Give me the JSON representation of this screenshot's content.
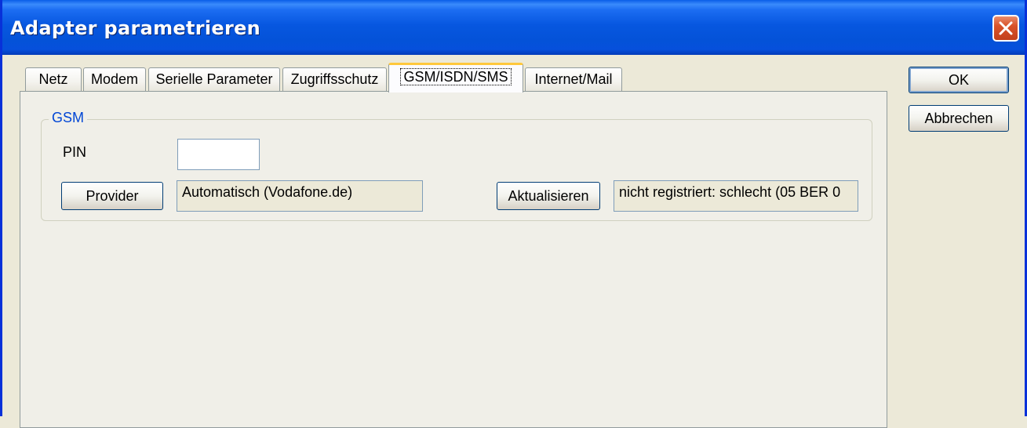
{
  "window": {
    "title": "Adapter parametrieren"
  },
  "tabs": [
    {
      "label": "Netz"
    },
    {
      "label": "Modem"
    },
    {
      "label": "Serielle Parameter"
    },
    {
      "label": "Zugriffsschutz"
    },
    {
      "label": "GSM/ISDN/SMS",
      "active": true
    },
    {
      "label": "Internet/Mail"
    }
  ],
  "dialog_buttons": {
    "ok": "OK",
    "cancel": "Abbrechen"
  },
  "gsm": {
    "group_title": "GSM",
    "pin_label": "PIN",
    "pin_value": "",
    "provider_button": "Provider",
    "provider_value": "Automatisch (Vodafone.de)",
    "refresh_button": "Aktualisieren",
    "status_value": "nicht registriert: schlecht (05 BER 0"
  },
  "colors": {
    "titlebar": "#0757E0",
    "group_title": "#0046D5",
    "active_tab_accent": "#FFC83C",
    "close_button": "#D9532A"
  }
}
